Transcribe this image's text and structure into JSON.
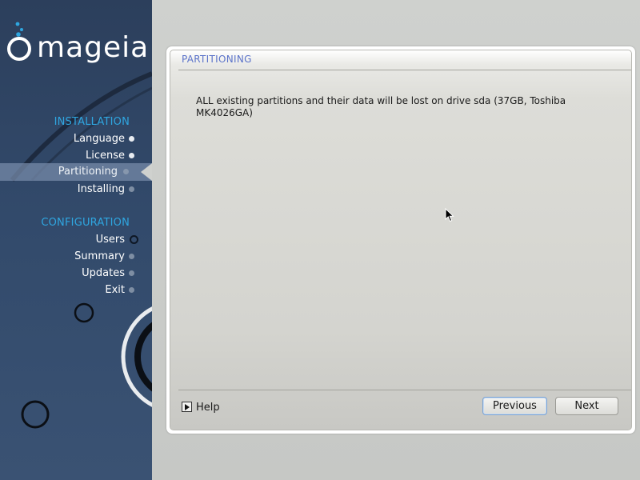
{
  "sidebar": {
    "logo_text": "mageia",
    "sections": [
      {
        "title": "INSTALLATION",
        "steps": [
          "Language",
          "License",
          "Partitioning",
          "Installing"
        ]
      },
      {
        "title": "CONFIGURATION",
        "steps": [
          "Users",
          "Summary",
          "Updates",
          "Exit"
        ]
      }
    ],
    "active_step": "Partitioning"
  },
  "panel": {
    "title": "PARTITIONING",
    "message": "ALL existing partitions and their data will be lost on drive sda (37GB, Toshiba MK4026GA)"
  },
  "footer": {
    "help_label": "Help",
    "previous_label": "Previous",
    "next_label": "Next"
  },
  "colors": {
    "sidebar_bg": "#324a6b",
    "section_title": "#2fa6e0",
    "panel_title": "#5b73c9",
    "logo_bubbles": "#2fa6e0"
  }
}
